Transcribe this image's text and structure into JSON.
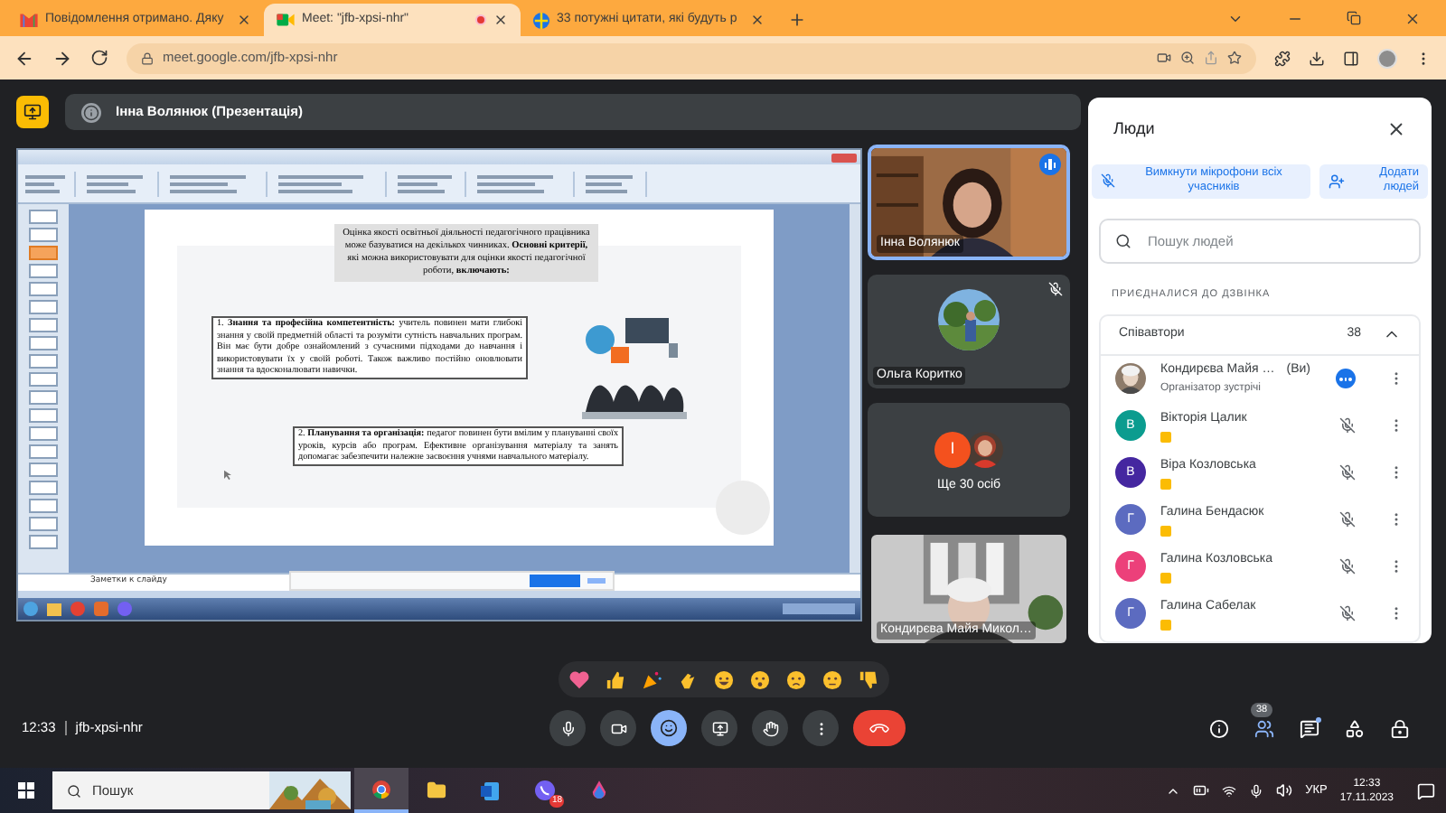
{
  "browser": {
    "tabs": [
      {
        "title": "Повідомлення отримано. Дяку",
        "selected": false,
        "recording": false,
        "kind": "mail"
      },
      {
        "title": "Meet: \"jfb-xpsi-nhr\"",
        "selected": true,
        "recording": true,
        "kind": "meet"
      },
      {
        "title": "33 потужні цитати, які будуть р",
        "selected": false,
        "recording": false,
        "kind": "site"
      }
    ],
    "url": "meet.google.com/jfb-xpsi-nhr"
  },
  "banner": {
    "text": "Інна Волянюк (Презентація)"
  },
  "presentation": {
    "slide_title": "Оцінка якості освітньої діяльності педагогічного працівника може базуватися на декількох чинниках. **Основні критерії,** які можна використовувати для оцінки якості педагогічної роботи, **включають:**",
    "items": [
      "1. **Знання та професійна компетентність:** учитель повинен мати глибокі знання у своїй предметній області та розуміти сутність навчальних програм. Він має бути добре ознайомлений з сучасними підходами до навчання і використовувати їх у своїй роботі. Також важливо постійно оновлювати знання та вдосконалювати навички.",
      "2. **Планування та організація:** педагог повинен бути вмілим у плануванні своїх уроків, курсів або програм. Ефективне організування матеріалу та занять допомагає забезпечити належне засвоєння учнями навчального матеріалу."
    ],
    "notes": "Заметки к слайду"
  },
  "tiles": [
    {
      "kind": "video",
      "name": "Інна Волянюк",
      "speaking": true
    },
    {
      "kind": "avatar",
      "name": "Ольга Коритко",
      "muted": true
    },
    {
      "kind": "more",
      "name": "Ще 30 осіб",
      "initial": "І"
    },
    {
      "kind": "video",
      "name": "Кондирєва Майя Микол…",
      "speaking": false
    }
  ],
  "people": {
    "title": "Люди",
    "mute_all": "Вимкнути мікрофони всіх учасників",
    "add": "Додати людей",
    "search": {
      "placeholder": "Пошук людей"
    },
    "section": "ПРИЄДНАЛИСЯ ДО ДЗВІНКА",
    "group": {
      "label": "Співавтори",
      "count": "38",
      "expanded": true
    },
    "members": [
      {
        "name": "Кондирєва Майя …",
        "you": "(Ви)",
        "role": "Організатор зустрічі",
        "muted": false
      },
      {
        "kind": "initial",
        "initial": "В",
        "color": "#0b9c8f",
        "name": "Вікторія Цалик",
        "muted": true
      },
      {
        "kind": "initial",
        "initial": "В",
        "color": "#4527a0",
        "name": "Віра Козловська",
        "muted": true
      },
      {
        "kind": "initial",
        "initial": "Г",
        "color": "#5c6bc0",
        "name": "Галина Бендасюк",
        "muted": true
      },
      {
        "kind": "initial",
        "initial": "Г",
        "color": "#ec407a",
        "name": "Галина Козловська",
        "muted": true
      },
      {
        "kind": "initial",
        "initial": "Г",
        "color": "#5c6bc0",
        "name": "Галина Сабелак",
        "muted": true
      }
    ]
  },
  "reactions": {
    "open": true
  },
  "call": {
    "time": "12:33",
    "code": "jfb-xpsi-nhr",
    "people_count": "38"
  },
  "taskbar": {
    "search": {
      "placeholder": "Пошук"
    },
    "viber_badge": "18",
    "language": "УКР",
    "time": "12:33",
    "date": "17.11.2023"
  }
}
